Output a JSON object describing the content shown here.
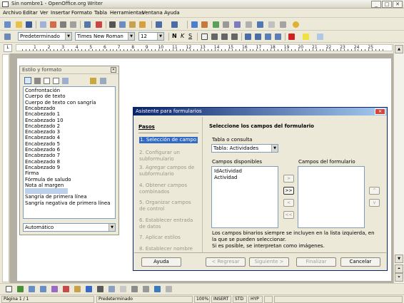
{
  "window": {
    "title": "Sin nombre1 - OpenOffice.org Writer"
  },
  "menubar": [
    "Archivo",
    "Editar",
    "Ver",
    "Insertar",
    "Formato",
    "Tabla",
    "Herramientas",
    "Ventana",
    "Ayuda"
  ],
  "format_toolbar": {
    "style": "Predeterminado",
    "font": "Times New Roman",
    "size": "12"
  },
  "ruler_numbers": [
    "1",
    "2",
    "3",
    "4",
    "5",
    "6",
    "7",
    "8",
    "9",
    "10",
    "11",
    "12",
    "13",
    "14",
    "15",
    "16",
    "17",
    "18",
    "19",
    "20",
    "21",
    "22",
    "23",
    "24",
    "25"
  ],
  "style_panel": {
    "title": "Estilo y formato",
    "items": [
      "Confrontación",
      "Cuerpo de texto",
      "Cuerpo de texto con sangría",
      "Encabezado",
      "Encabezado 1",
      "Encabezado 10",
      "Encabezado 2",
      "Encabezado 3",
      "Encabezado 4",
      "Encabezado 5",
      "Encabezado 6",
      "Encabezado 7",
      "Encabezado 8",
      "Encabezado 9",
      "Firma",
      "Fórmula de saludo",
      "Nota al margen",
      "Predeterminado",
      "Sangría de primera línea",
      "Sangría negativa de primera línea"
    ],
    "selected_index": 17,
    "filter": "Automático"
  },
  "dialog": {
    "title": "Asistente para formularios",
    "steps_heading": "Pasos",
    "steps": [
      "1. Selección de campo",
      "2. Configurar un subformulario",
      "3. Agregar campos de subformulario",
      "4. Obtener campos combinados",
      "5. Organizar campos de control",
      "6. Establecer entrada de datos",
      "7. Aplicar estilos",
      "8. Establecer nombre"
    ],
    "active_step": 0,
    "heading": "Seleccione los campos del formulario",
    "table_label": "Tabla o consulta",
    "table_value": "Tabla: Actividades",
    "available_label": "Campos disponibles",
    "available_fields": [
      "IdActividad",
      "Actividad"
    ],
    "form_fields_label": "Campos del formulario",
    "move_buttons": [
      ">",
      ">>",
      "<",
      "<<"
    ],
    "order_buttons": [
      "^",
      "v"
    ],
    "note": "Los campos binarios siempre se incluyen en la lista izquierda, en la que se pueden seleccionar.\nSi es posible, se interpretan como imágenes.",
    "buttons": {
      "help": "Ayuda",
      "back": "< Regresar",
      "next": "Siguiente >",
      "finish": "Finalizar",
      "cancel": "Cancelar"
    }
  },
  "statusbar": {
    "page": "Página 1 / 1",
    "style": "Predeterminado",
    "zoom": "100%",
    "insert": "INSERT",
    "std": "STD",
    "hyp": "HYP"
  }
}
